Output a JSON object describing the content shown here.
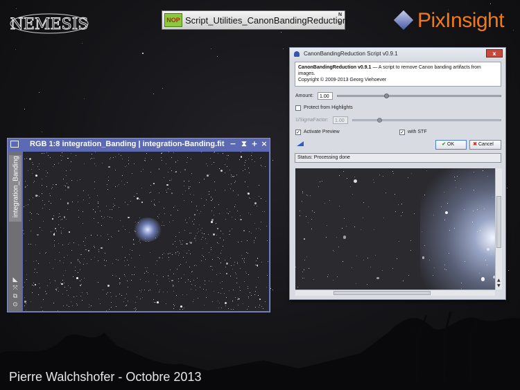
{
  "branding": {
    "left_logo": "NEMESIS",
    "right_logo": "PixInsight"
  },
  "process_icon": {
    "badge": "NOP",
    "label": "Script_Utilities_CanonBandingReduction",
    "corner_top": "N",
    "corner_bottom": "D"
  },
  "image_window": {
    "title": "RGB 1:8 integration_Banding | integration-Banding.fit",
    "view_tab": "integration_Banding",
    "controls": [
      "−",
      "⧗",
      "+",
      "×"
    ]
  },
  "dialog": {
    "title": "CanonBandingReduction Script v0.9.1",
    "info_name": "CanonBandingReduction v0.9.1",
    "info_desc": " — A script to remove Canon banding artifacts from images.",
    "info_copyright": "Copyright © 2009-2013 Georg Viehoever",
    "amount_label": "Amount:",
    "amount_value": "1.00",
    "amount_fraction": 0.3,
    "protect_label": "Protect from Highlights",
    "protect_checked": false,
    "sigma_label": "1/SigmaFactor:",
    "sigma_value": "1.00",
    "sigma_fraction": 0.0,
    "activate_preview_label": "Activate Preview",
    "activate_preview_checked": true,
    "stf_label": "with STF",
    "stf_checked": true,
    "ok_label": "OK",
    "cancel_label": "Cancel",
    "close_label": "x",
    "status": "Status: Processing done"
  },
  "footer": {
    "credit": "Pierre Walchshofer - Octobre 2013"
  },
  "colors": {
    "pixinsight_orange": "#f07a1a",
    "window_title_blue": "#5b6ab2",
    "ok_check": "#2f9a2a",
    "cancel_x": "#c8322a"
  }
}
